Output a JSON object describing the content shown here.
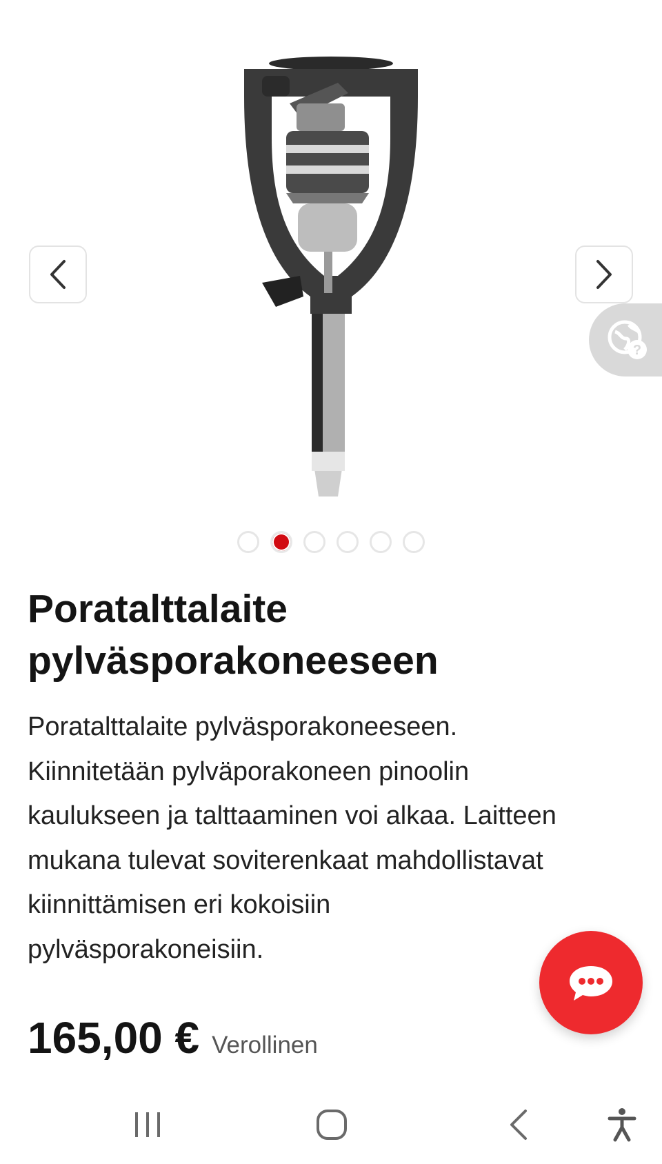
{
  "gallery": {
    "prev_icon": "chevron-left-icon",
    "next_icon": "chevron-right-icon",
    "translate_icon": "globe-question-icon",
    "slide_count": 6,
    "active_slide": 2
  },
  "product": {
    "title_line1": "Poratalttalaite",
    "title_line2": "pylväsporakoneeseen",
    "description_lines": [
      "Poratalttalaite pylväsporakoneeseen.",
      "Kiinnitetään pylväporakoneen pinoolin",
      "kaulukseen ja talttaaminen voi alkaa. Laitteen",
      "mukana tulevat soviterenkaat mahdollistavat",
      "kiinnittämisen eri kokoisiin",
      "pylväsporakoneisiin."
    ],
    "price": "165,00 €",
    "tax_label": "Verollinen"
  },
  "chat": {
    "icon": "chat-bubble-icon"
  },
  "system_nav": {
    "recents_icon": "recents-icon",
    "home_icon": "home-icon",
    "back_icon": "back-icon",
    "accessibility_icon": "accessibility-icon"
  },
  "colors": {
    "accent_red": "#d10a11",
    "fab_red": "#ee2a2e",
    "dot_border": "#e6e6e6"
  }
}
